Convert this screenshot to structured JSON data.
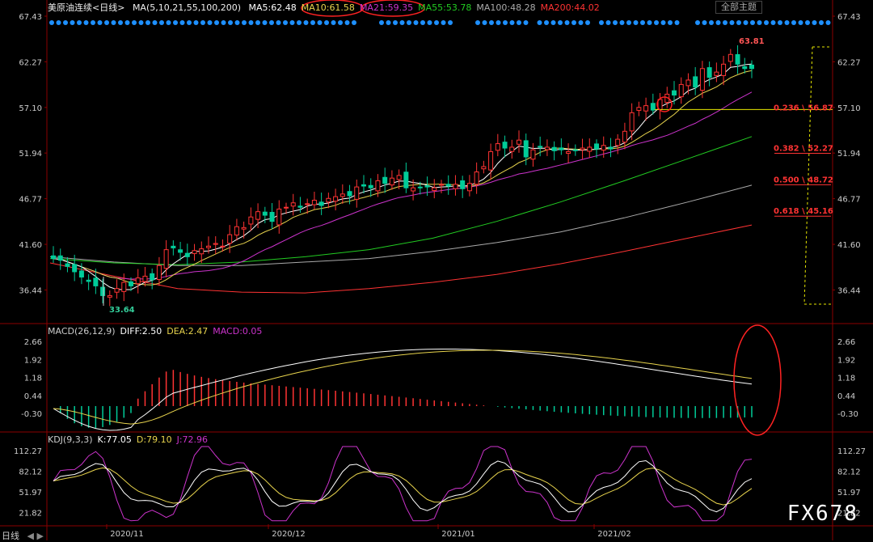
{
  "header": {
    "instrument": "美原油连续<日线>",
    "ma_label": "MA(5,10,21,55,100,200)",
    "ma_values": [
      {
        "text": "MA5:62.48",
        "color": "#ffffff"
      },
      {
        "text": "MA10:61.58",
        "color": "#e8d44d"
      },
      {
        "text": "MA21:59.35",
        "color": "#cc33cc"
      },
      {
        "text": "MA55:53.78",
        "color": "#22cc22"
      },
      {
        "text": "MA100:48.28",
        "color": "#aaaaaa"
      },
      {
        "text": "MA200:44.02",
        "color": "#ff3333"
      }
    ],
    "theme_button": "全部主题"
  },
  "macd_header": {
    "label": "MACD(26,12,9)",
    "diff": "DIFF:2.50",
    "dea": "DEA:2.47",
    "macd": "MACD:0.05"
  },
  "kdj_header": {
    "label": "KDJ(9,3,3)",
    "k": "K:77.05",
    "d": "D:79.10",
    "j": "J:72.96"
  },
  "bottom": {
    "period": "日线"
  },
  "watermark": "FX678",
  "colors": {
    "up": "#ff3333",
    "down": "#00cc99",
    "ma5": "#ffffff",
    "ma10": "#e8d44d",
    "ma21": "#cc33cc",
    "ma55": "#22cc22",
    "ma100": "#aaaaaa",
    "ma200": "#ff3333",
    "fib": "#e8e800",
    "axis": "#8b0000",
    "dots": "#1e90ff"
  },
  "chart_data": [
    {
      "type": "candlestick",
      "y_ticks": [
        67.43,
        62.27,
        57.1,
        51.94,
        46.77,
        41.6,
        36.44
      ],
      "ylim": [
        33.0,
        67.43
      ],
      "x_ticks": [
        "2020/11",
        "2020/12",
        "2021/01",
        "2021/02"
      ],
      "high_label": "63.81",
      "low_label": "33.64",
      "fib_levels": [
        {
          "label": "0.236 \\ 56.87",
          "value": 56.87
        },
        {
          "label": "0.382 \\ 52.27",
          "value": 52.27
        },
        {
          "label": "0.500 \\ 48.72",
          "value": 48.72
        },
        {
          "label": "0.618 \\ 45.16",
          "value": 45.16
        }
      ],
      "closes": [
        40.0,
        39.8,
        39.1,
        38.5,
        37.9,
        37.4,
        36.9,
        35.8,
        35.8,
        36.6,
        37.3,
        36.9,
        37.8,
        38.0,
        37.6,
        39.2,
        41.0,
        41.2,
        40.7,
        40.2,
        40.9,
        41.1,
        41.4,
        41.7,
        41.4,
        42.7,
        43.6,
        43.5,
        44.7,
        45.3,
        44.9,
        44.2,
        45.6,
        45.8,
        46.3,
        45.8,
        46.2,
        46.6,
        46.0,
        46.8,
        47.0,
        47.3,
        47.1,
        48.1,
        48.2,
        48.0,
        48.8,
        48.5,
        49.1,
        49.4,
        48.0,
        48.0,
        48.0,
        48.1,
        48.0,
        48.4,
        48.2,
        48.4,
        47.9,
        48.5,
        49.8,
        50.4,
        52.1,
        53.0,
        52.5,
        52.6,
        53.4,
        51.5,
        52.3,
        52.6,
        52.6,
        52.2,
        52.3,
        52.1,
        52.2,
        52.5,
        52.6,
        52.4,
        52.8,
        52.4,
        53.5,
        54.4,
        56.5,
        57.1,
        57.3,
        56.8,
        58.0,
        58.6,
        58.5,
        59.7,
        60.2,
        59.4,
        61.5,
        60.5,
        61.1,
        62.0,
        63.1,
        62.0,
        61.5,
        61.5
      ]
    },
    {
      "type": "line",
      "name_label": "MACD(26,12,9)",
      "y_ticks": [
        2.66,
        1.92,
        1.18,
        0.44,
        -0.3
      ],
      "ylim": [
        -1.0,
        3.0
      ]
    },
    {
      "type": "line",
      "name_label": "KDJ(9,3,3)",
      "y_ticks": [
        112.27,
        82.12,
        51.97,
        21.82
      ],
      "ylim": [
        5,
        125
      ]
    }
  ]
}
